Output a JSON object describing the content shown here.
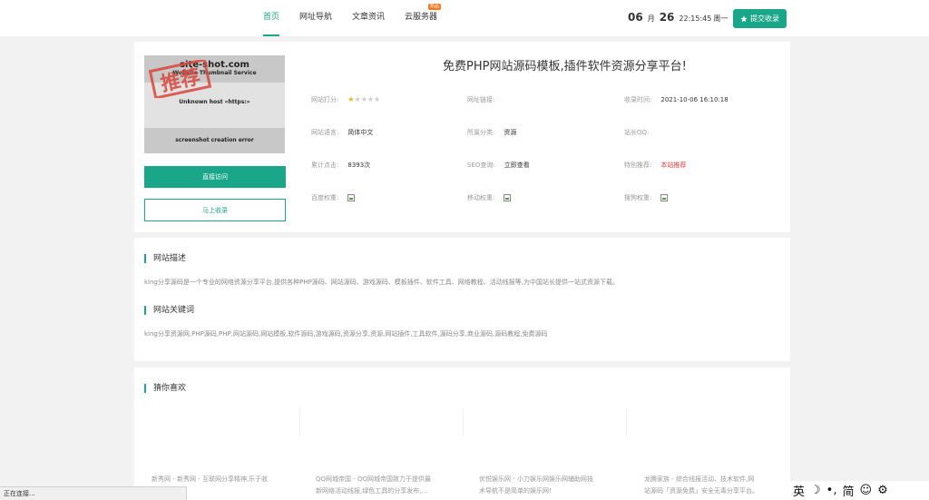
{
  "nav": {
    "items": [
      {
        "label": "首页",
        "active": true
      },
      {
        "label": "网址导航"
      },
      {
        "label": "文章资讯"
      },
      {
        "label": "云服务器",
        "badge": "新品"
      }
    ]
  },
  "date": {
    "month": "06",
    "month_unit": "月",
    "day": "26",
    "time": "22:15:45",
    "weekday": "周一"
  },
  "submit_button": "提交收录",
  "thumbnail": {
    "site": "site-shot.com",
    "sub": "Website Thumbnail Service",
    "error": "Unknown host «https:»",
    "footer": "screenshot creation error",
    "stamp": "推荐"
  },
  "buttons": {
    "visit": "直接访问",
    "collect": "马上收录"
  },
  "site_title": "免费PHP网站源码模板,插件软件资源分享平台!",
  "fields": {
    "rating_label": "网站打分:",
    "rating": 1,
    "rating_max": 5,
    "link_label": "网址链接:",
    "link_value": "",
    "added_label": "收录时间:",
    "added_value": "2021-10-06 16:10:18",
    "lang_label": "网站语言:",
    "lang_value": "简体中文",
    "category_label": "所属分类:",
    "category_value": "资源",
    "qq_label": "站长QQ:",
    "qq_value": "",
    "clicks_label": "累计点击:",
    "clicks_value": "8393次",
    "seo_label": "SEO查询:",
    "seo_value": "立即查看",
    "special_label": "特别推荐:",
    "special_value": "本站推荐",
    "baidu_label": "百度权重:",
    "mobile_label": "移动权重:",
    "sogou_label": "搜狗权重:"
  },
  "description": {
    "title": "网站描述",
    "text": "king分享源码是一个专业的网络资源分享平台,提供各种PHP源码、网站源码、游戏源码、模板插件、软件工具、网络教程、活动线报等,为中国站长提供一站式资源下载。"
  },
  "keywords": {
    "title": "网站关键词",
    "text": "king分享资源网,PHP源码,PHP,网站源码,网站模板,软件源码,游戏源码,资源分享,资源,网站插件,工具软件,源码分享,商业源码,源码教程,免费源码"
  },
  "like": {
    "title": "猜你喜欢",
    "items": [
      {
        "line1": "新秀网 - 新秀网 - 互联网分享精神,乐于收",
        "line2": ""
      },
      {
        "line1": "QQ网城帝国 - QQ网城帝国致力于提供最",
        "line2": "新网络活动线报,绿色工具的分享发布,..."
      },
      {
        "line1": "优悦娱乐网 - 小刀娱乐网娱乐网辅助网技",
        "line2": "术导航不是简单的娱乐网!"
      },
      {
        "line1": "龙腾家族 - 综合线报活动、技术软件,网",
        "line2": "站源码「资源免费」安全无毒分享平台。"
      }
    ]
  },
  "status": "正在连接...",
  "ime": [
    "英",
    "☽",
    "•,",
    "简",
    "☺",
    "⚙"
  ]
}
